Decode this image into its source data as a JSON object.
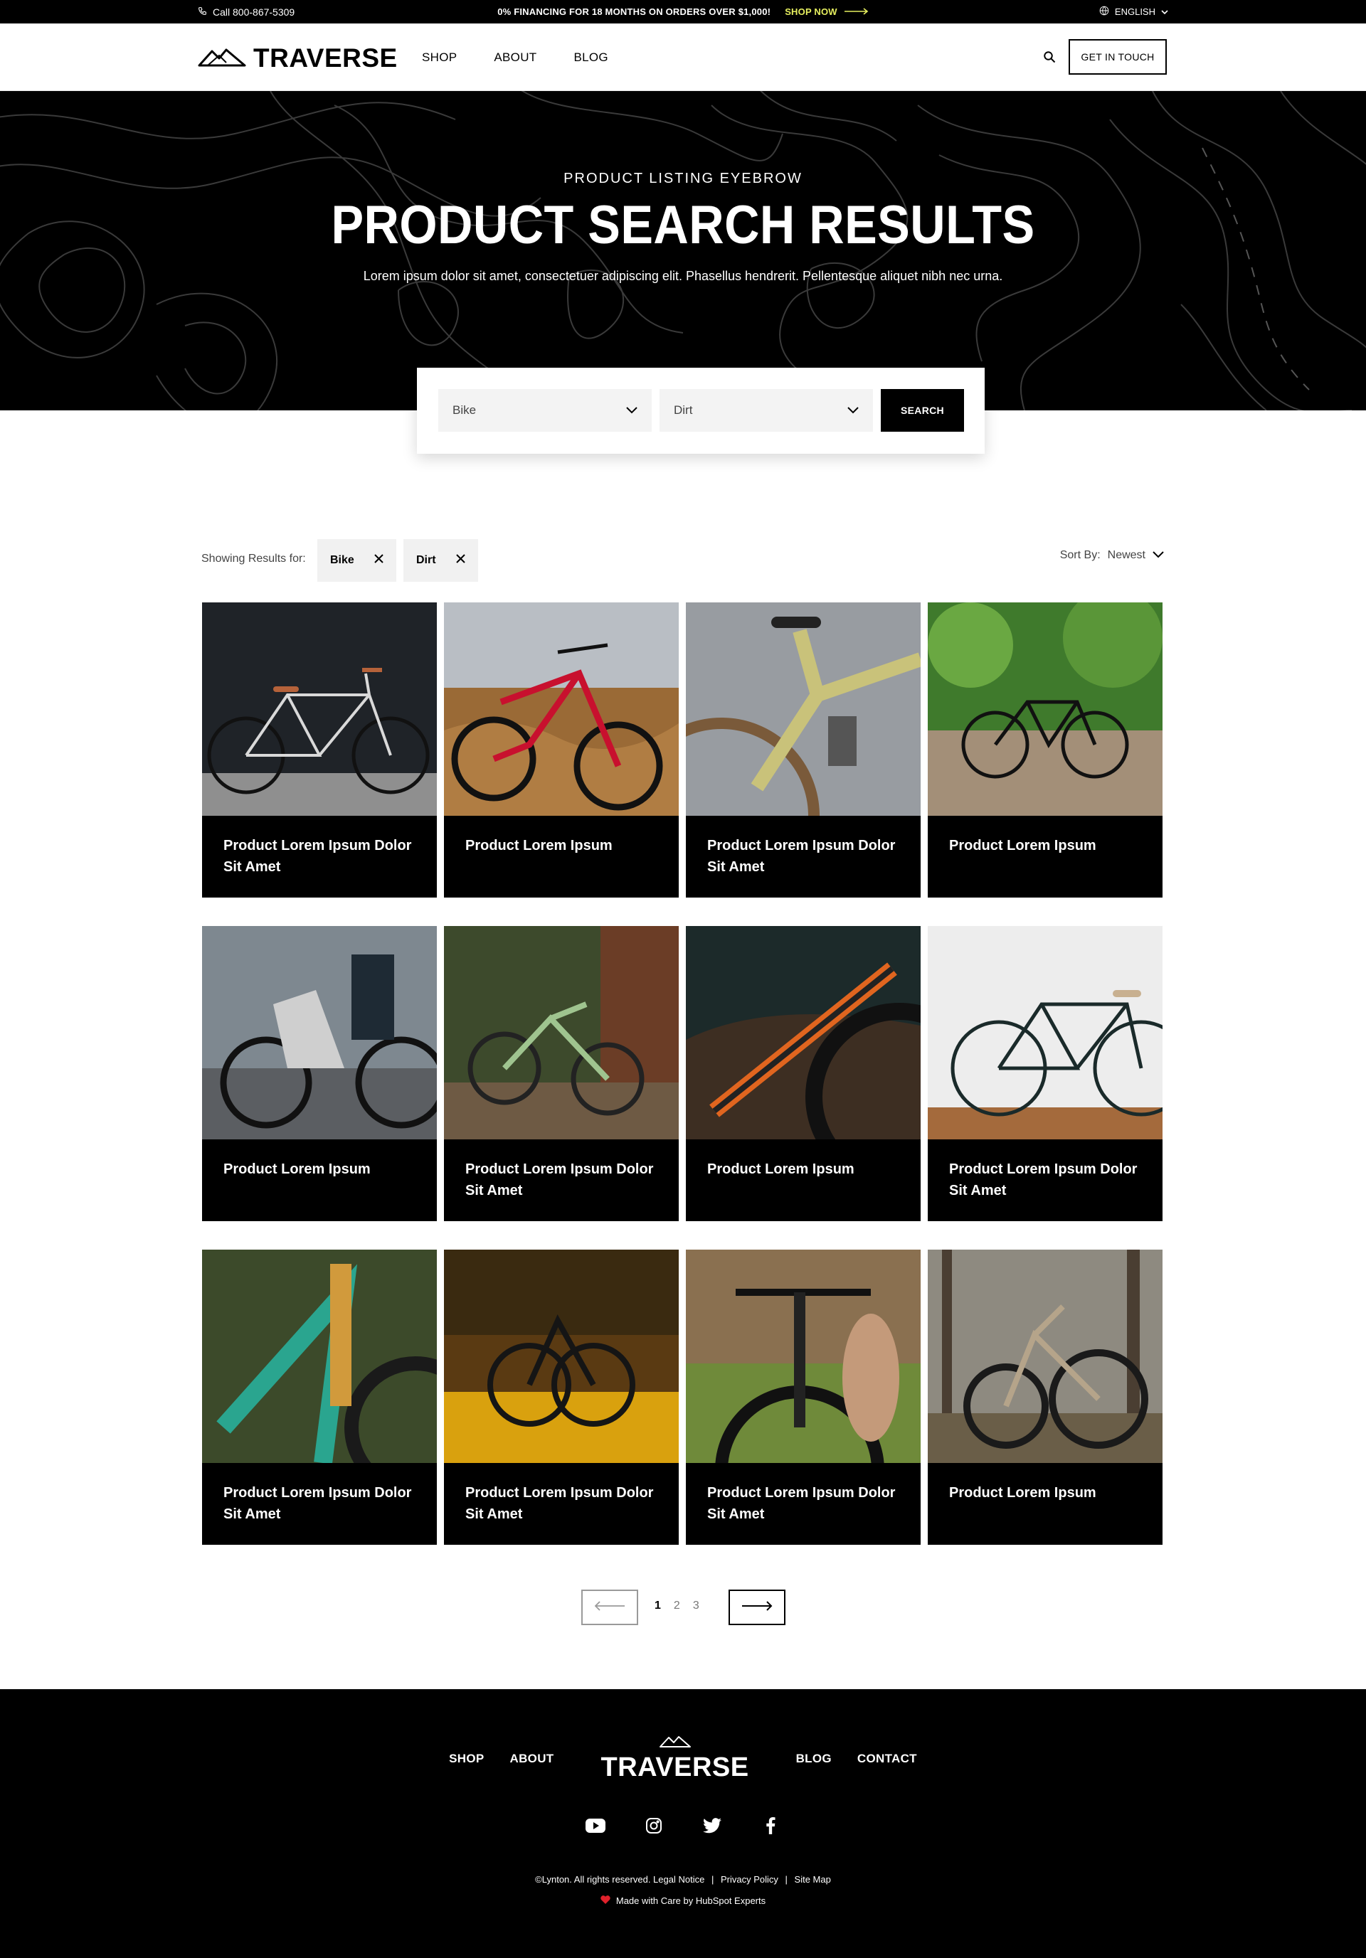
{
  "colors": {
    "accent": "#e6ef5f",
    "dark": "#000000",
    "chip_bg": "#f1f1f1"
  },
  "topbar": {
    "phone": "Call 800-867-5309",
    "promo": "0% FINANCING FOR 18 MONTHS ON ORDERS OVER $1,000!",
    "promo_link": "SHOP NOW",
    "language": "ENGLISH"
  },
  "header": {
    "logo": "TRAVERSE",
    "nav": [
      "SHOP",
      "ABOUT",
      "BLOG"
    ],
    "cta": "GET IN TOUCH"
  },
  "hero": {
    "eyebrow": "PRODUCT LISTING EYEBROW",
    "title": "PRODUCT SEARCH RESULTS",
    "subtitle": "Lorem ipsum dolor sit amet, consectetuer adipiscing elit. Phasellus hendrerit. Pellentesque aliquet nibh nec urna."
  },
  "search": {
    "select_1": "Bike",
    "select_2": "Dirt",
    "button": "SEARCH"
  },
  "filters": {
    "label": "Showing Results for:",
    "chips": [
      "Bike",
      "Dirt"
    ],
    "sort_label": "Sort By:",
    "sort_value": "Newest"
  },
  "products": [
    {
      "title": "Product Lorem Ipsum Dolor Sit Amet"
    },
    {
      "title": "Product Lorem Ipsum"
    },
    {
      "title": "Product Lorem Ipsum Dolor Sit Amet"
    },
    {
      "title": "Product Lorem Ipsum"
    },
    {
      "title": "Product Lorem Ipsum"
    },
    {
      "title": "Product Lorem Ipsum Dolor Sit Amet"
    },
    {
      "title": "Product Lorem Ipsum"
    },
    {
      "title": "Product Lorem Ipsum Dolor Sit Amet"
    },
    {
      "title": "Product Lorem Ipsum Dolor Sit Amet"
    },
    {
      "title": "Product Lorem Ipsum Dolor Sit Amet"
    },
    {
      "title": "Product Lorem Ipsum Dolor Sit Amet"
    },
    {
      "title": "Product Lorem Ipsum"
    }
  ],
  "pagination": {
    "pages": [
      "1",
      "2",
      "3"
    ],
    "current": "1"
  },
  "footer": {
    "nav_left": [
      "SHOP",
      "ABOUT"
    ],
    "logo": "TRAVERSE",
    "nav_right": [
      "BLOG",
      "CONTACT"
    ],
    "social": [
      "youtube-icon",
      "instagram-icon",
      "twitter-icon",
      "facebook-icon"
    ],
    "copyright": "©Lynton. All rights reserved. Legal Notice",
    "privacy": "Privacy Policy",
    "sitemap": "Site Map",
    "made": "Made with Care by HubSpot Experts"
  }
}
